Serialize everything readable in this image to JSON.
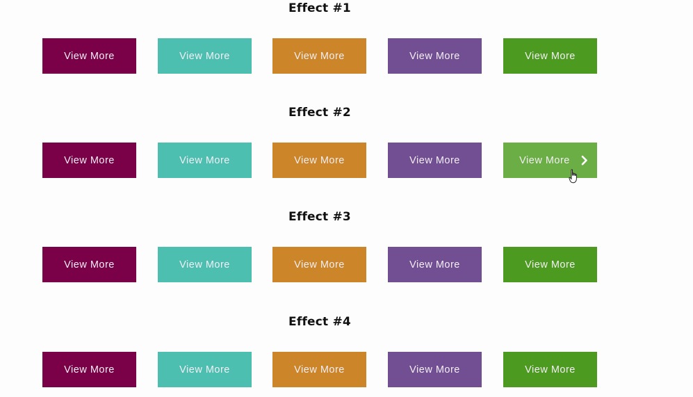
{
  "effects": [
    {
      "title": "Effect #1",
      "buttons": [
        {
          "label": "View More",
          "color": "#7a0047"
        },
        {
          "label": "View More",
          "color": "#4dbfb1"
        },
        {
          "label": "View More",
          "color": "#cc8529"
        },
        {
          "label": "View More",
          "color": "#714f92"
        },
        {
          "label": "View More",
          "color": "#4c9a20"
        }
      ]
    },
    {
      "title": "Effect #2",
      "buttons": [
        {
          "label": "View More",
          "color": "#7a0047"
        },
        {
          "label": "View More",
          "color": "#4dbfb1"
        },
        {
          "label": "View More",
          "color": "#cc8529"
        },
        {
          "label": "View More",
          "color": "#714f92"
        },
        {
          "label": "View More",
          "color": "#6aae45",
          "hovered": true,
          "icon": "chevron-right-icon"
        }
      ]
    },
    {
      "title": "Effect #3",
      "buttons": [
        {
          "label": "View More",
          "color": "#7a0047"
        },
        {
          "label": "View More",
          "color": "#4dbfb1"
        },
        {
          "label": "View More",
          "color": "#cc8529"
        },
        {
          "label": "View More",
          "color": "#714f92"
        },
        {
          "label": "View More",
          "color": "#4c9a20"
        }
      ]
    },
    {
      "title": "Effect #4",
      "buttons": [
        {
          "label": "View More",
          "color": "#7a0047"
        },
        {
          "label": "View More",
          "color": "#4dbfb1"
        },
        {
          "label": "View More",
          "color": "#cc8529"
        },
        {
          "label": "View More",
          "color": "#714f92"
        },
        {
          "label": "View More",
          "color": "#4c9a20"
        }
      ]
    }
  ]
}
